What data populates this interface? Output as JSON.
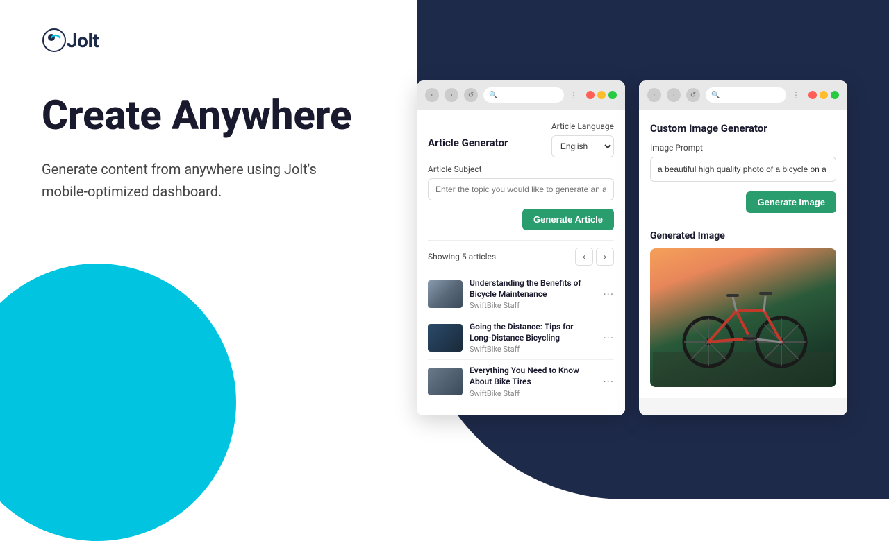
{
  "logo": {
    "text": "Jolt",
    "dot": "·"
  },
  "hero": {
    "title": "Create Anywhere",
    "subtitle": "Generate content from anywhere using Jolt's mobile-optimized dashboard."
  },
  "article_generator": {
    "panel_title": "Article Generator",
    "language_label": "Article Language",
    "language_value": "English",
    "subject_label": "Article Subject",
    "subject_placeholder": "Enter the topic you would like to generate an a...",
    "generate_btn": "Generate Article",
    "showing_label": "Showing 5 articles",
    "articles": [
      {
        "title": "Understanding the Benefits of Bicycle Maintenance",
        "author": "SwiftBike Staff"
      },
      {
        "title": "Going the Distance: Tips for Long-Distance Bicycling",
        "author": "SwiftBike Staff"
      },
      {
        "title": "Everything You Need to Know About Bike Tires",
        "author": "SwiftBike Staff"
      }
    ]
  },
  "image_generator": {
    "panel_title": "Custom Image Generator",
    "prompt_label": "Image Prompt",
    "prompt_value": "a beautiful high quality photo of a bicycle on a",
    "generate_btn": "Generate Image",
    "generated_label": "Generated Image"
  },
  "browser": {
    "nav_back": "‹",
    "nav_fwd": "›",
    "nav_refresh": "↺"
  }
}
